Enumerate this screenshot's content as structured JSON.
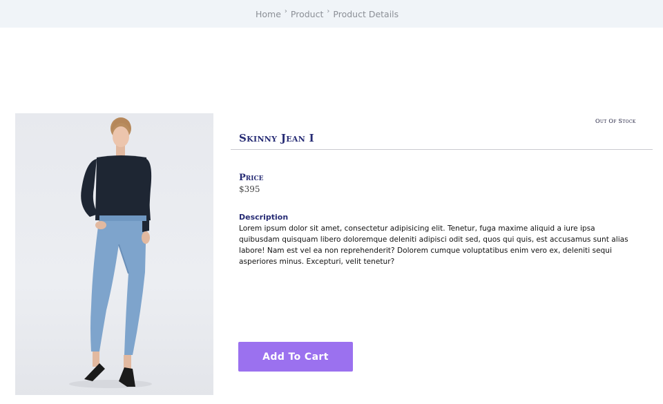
{
  "breadcrumb": {
    "items": [
      "Home",
      "Product",
      "Product Details"
    ],
    "separator": "›"
  },
  "product": {
    "stock_status": "Out Of Stock",
    "title": "Skinny Jean I",
    "price_label": "Price",
    "price": "$395",
    "description_label": "Description",
    "description": "Lorem ipsum dolor sit amet, consectetur adipisicing elit. Tenetur, fuga maxime aliquid a iure ipsa quibusdam quisquam libero doloremque deleniti adipisci odit sed, quos qui quis, est accusamus sunt alias labore! Nam est vel ea non reprehenderit? Dolorem cumque voluptatibus enim vero ex, deleniti sequi asperiores minus. Excepturi, velit tenetur?",
    "add_to_cart_label": "Add To Cart"
  },
  "colors": {
    "accent": "#9b71ef",
    "heading": "#262b74",
    "breadcrumb_bg": "#f0f4f8"
  }
}
